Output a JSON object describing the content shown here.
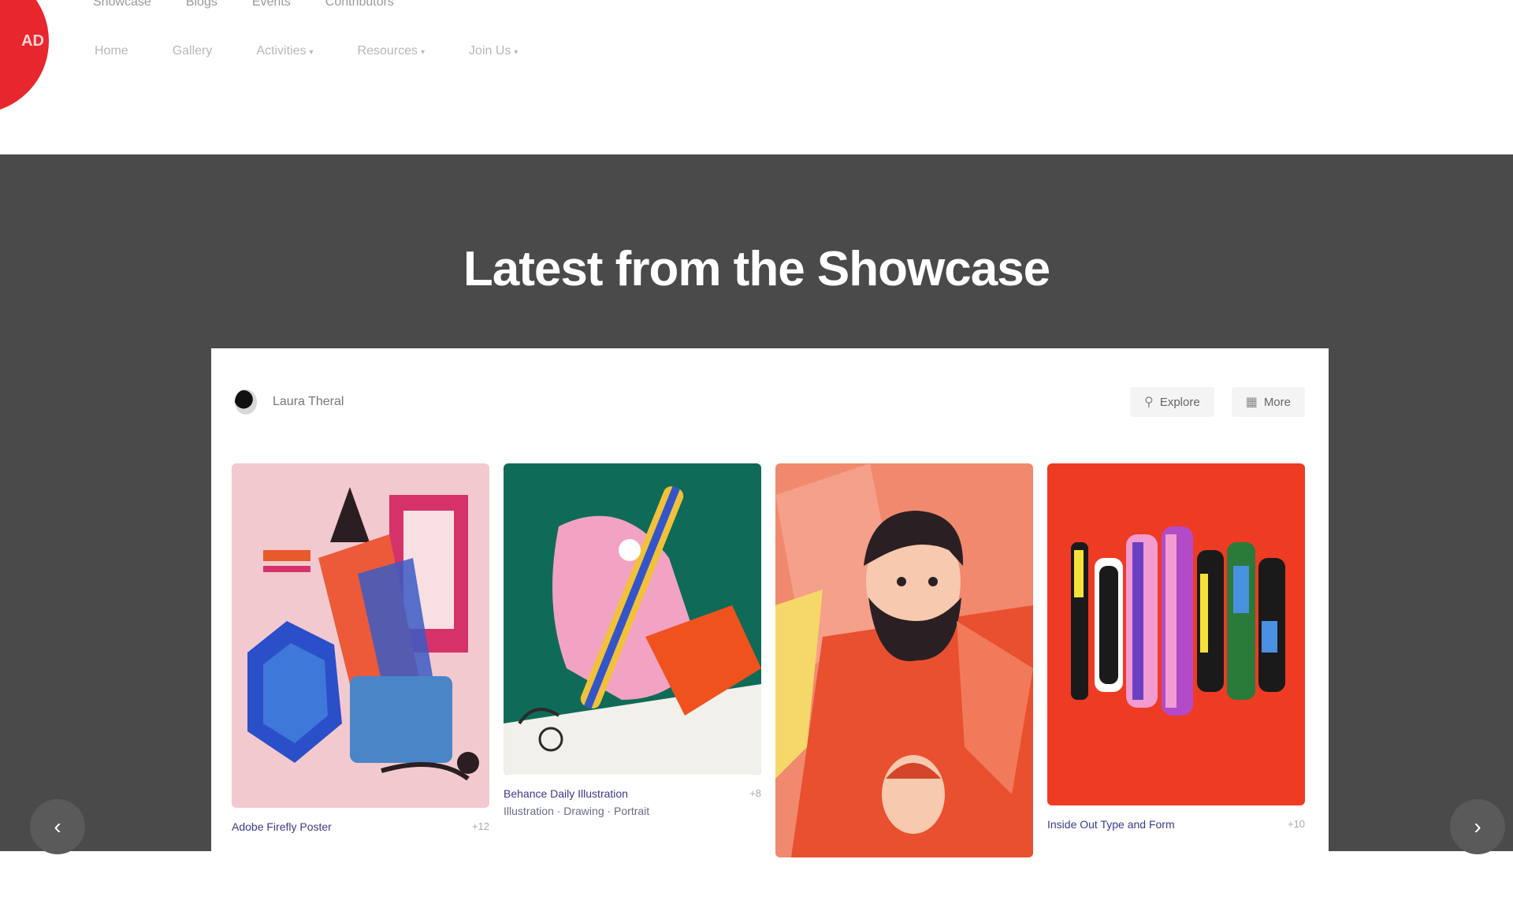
{
  "header": {
    "logo_text": "AD",
    "top_nav": [
      "Showcase",
      "Blogs",
      "Events",
      "Contributors"
    ],
    "sub_nav": [
      {
        "label": "Home",
        "has_menu": false
      },
      {
        "label": "Gallery",
        "has_menu": false
      },
      {
        "label": "Activities",
        "has_menu": true
      },
      {
        "label": "Resources",
        "has_menu": true
      },
      {
        "label": "Join Us",
        "has_menu": true
      }
    ]
  },
  "showcase": {
    "title": "Latest from the Showcase",
    "panel": {
      "user_name": "Laura Theral",
      "explore_label": "Explore",
      "more_label": "More"
    },
    "cards": [
      {
        "title": "Adobe Firefly Poster",
        "meta": "+12",
        "subtitle": ""
      },
      {
        "title": "Behance Daily Illustration",
        "meta": "+8",
        "subtitle": "Illustration · Drawing · Portrait"
      },
      {
        "title": "",
        "meta": "",
        "subtitle": ""
      },
      {
        "title": "Inside Out Type and Form",
        "meta": "+10",
        "subtitle": ""
      }
    ],
    "prev_icon": "chevron-left-icon",
    "next_icon": "chevron-right-icon"
  },
  "colors": {
    "brand_red": "#e8262d",
    "showcase_bg": "#4a4a4a"
  }
}
